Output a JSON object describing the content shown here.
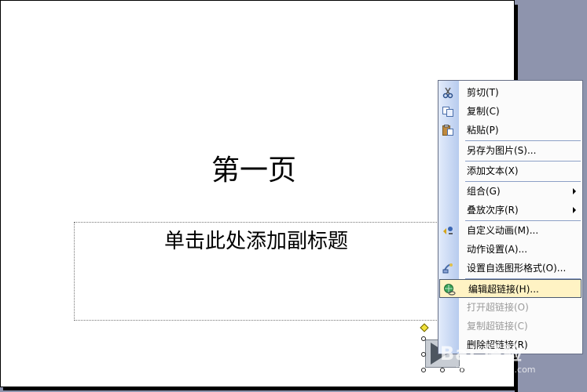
{
  "slide": {
    "title": "第一页",
    "subtitle": "单击此处添加副标题"
  },
  "context_menu": {
    "items": [
      {
        "label": "剪切(T)",
        "icon": "scissors-icon",
        "enabled": true
      },
      {
        "label": "复制(C)",
        "icon": "copy-icon",
        "enabled": true
      },
      {
        "label": "粘贴(P)",
        "icon": "paste-icon",
        "enabled": true
      },
      {
        "label": "另存为图片(S)...",
        "icon": "",
        "enabled": true
      },
      {
        "label": "添加文本(X)",
        "icon": "",
        "enabled": true
      },
      {
        "label": "组合(G)",
        "icon": "",
        "enabled": true,
        "submenu": true
      },
      {
        "label": "叠放次序(R)",
        "icon": "",
        "enabled": true,
        "submenu": true
      },
      {
        "label": "自定义动画(M)...",
        "icon": "custom-animation-icon",
        "enabled": true
      },
      {
        "label": "动作设置(A)...",
        "icon": "",
        "enabled": true
      },
      {
        "label": "设置自选图形格式(O)...",
        "icon": "format-shape-icon",
        "enabled": true
      },
      {
        "label": "编辑超链接(H)...",
        "icon": "hyperlink-globe-icon",
        "enabled": true,
        "highlighted": true
      },
      {
        "label": "打开超链接(O)",
        "icon": "",
        "enabled": false
      },
      {
        "label": "复制超链接(C)",
        "icon": "",
        "enabled": false
      },
      {
        "label": "删除超链接(R)",
        "icon": "",
        "enabled": true
      }
    ]
  },
  "watermark": {
    "top": "Bai 经验",
    "bottom": "jingyan.baidu.com"
  },
  "colors": {
    "menu_highlight": "#fff3c4",
    "menu_gutter": "#b7cbee",
    "workspace_bg": "#8e94ad"
  }
}
